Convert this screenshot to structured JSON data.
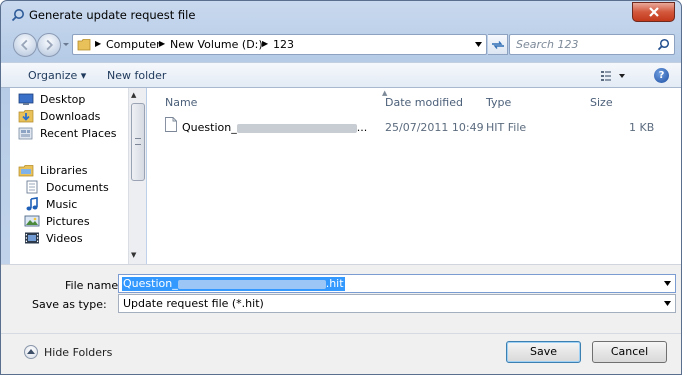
{
  "window": {
    "title": "Generate update request file"
  },
  "address": {
    "crumbs": [
      "Computer",
      "New Volume (D:)",
      "123"
    ],
    "search_placeholder": "Search 123"
  },
  "toolbar": {
    "organize": "Organize ▾",
    "new_folder": "New folder",
    "help": "?"
  },
  "nav": {
    "items": [
      {
        "label": "Desktop",
        "icon": "desktop-icon"
      },
      {
        "label": "Downloads",
        "icon": "downloads-icon"
      },
      {
        "label": "Recent Places",
        "icon": "recent-places-icon"
      },
      {
        "label": "Libraries",
        "icon": "libraries-icon"
      },
      {
        "label": "Documents",
        "icon": "documents-icon"
      },
      {
        "label": "Music",
        "icon": "music-icon"
      },
      {
        "label": "Pictures",
        "icon": "pictures-icon"
      },
      {
        "label": "Videos",
        "icon": "videos-icon"
      }
    ]
  },
  "files": {
    "columns": [
      "Name",
      "Date modified",
      "Type",
      "Size"
    ],
    "rows": [
      {
        "name": "Question_",
        "date": "25/07/2011 10:49",
        "type": "HIT File",
        "size": "1 KB"
      }
    ]
  },
  "form": {
    "file_name_label": "File name:",
    "file_name_value": "Question_",
    "file_name_ext": "hit",
    "save_type_label": "Save as type:",
    "save_type_value": "Update request file (*.hit)"
  },
  "buttons": {
    "hide_folders": "Hide Folders",
    "save": "Save",
    "cancel": "Cancel"
  }
}
